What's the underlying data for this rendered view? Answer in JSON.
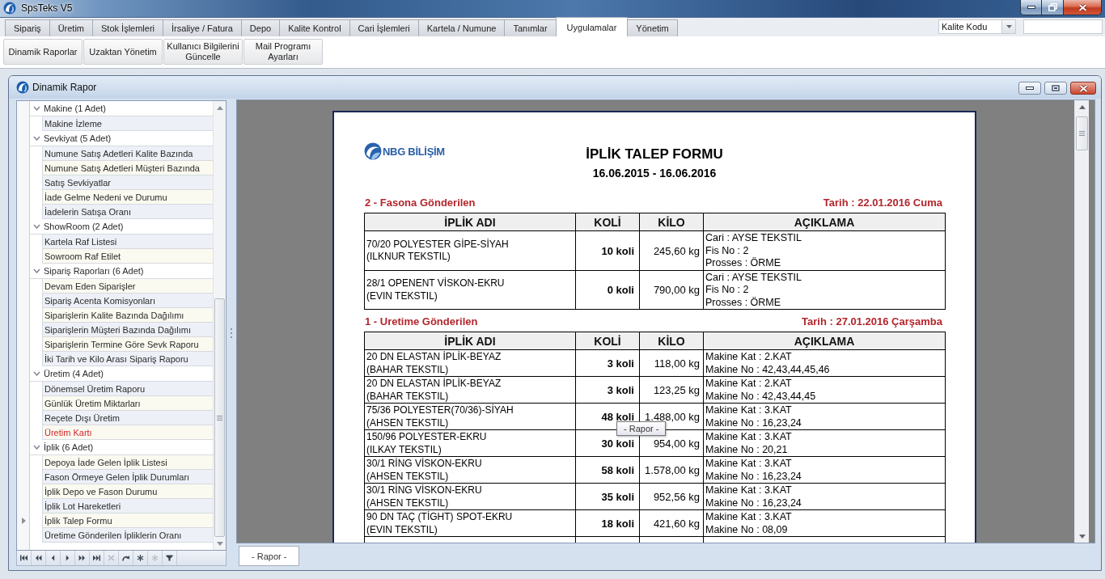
{
  "window": {
    "title": "SpsTeks V5"
  },
  "menu_tabs": [
    {
      "label": "Sipariş",
      "selected": false
    },
    {
      "label": "Üretim",
      "selected": false
    },
    {
      "label": "Stok İşlemleri",
      "selected": false
    },
    {
      "label": "İrsaliye / Fatura",
      "selected": false
    },
    {
      "label": "Depo",
      "selected": false
    },
    {
      "label": "Kalite Kontrol",
      "selected": false
    },
    {
      "label": "Cari İşlemleri",
      "selected": false
    },
    {
      "label": "Kartela / Numune",
      "selected": false
    },
    {
      "label": "Tanımlar",
      "selected": false
    },
    {
      "label": "Uygulamalar",
      "selected": true
    },
    {
      "label": "Yönetim",
      "selected": false
    }
  ],
  "quick_search": {
    "field": "Kalite Kodu"
  },
  "ribbon": {
    "buttons": [
      "Dinamik Raporlar",
      "Uzaktan Yönetim",
      "Kullanıcı Bilgilerini\nGüncelle",
      "Mail Programı\nAyarları"
    ]
  },
  "child_window": {
    "title": "Dinamik Rapor"
  },
  "report_tree": {
    "groups": [
      {
        "label": "Makine (1 Adet)",
        "expanded": true,
        "children": [
          {
            "label": "Makine İzleme",
            "selected": false,
            "highlighted": false
          }
        ]
      },
      {
        "label": "Sevkiyat (5 Adet)",
        "expanded": true,
        "children": [
          {
            "label": "Numune Satış Adetleri Kalite Bazında",
            "selected": false,
            "highlighted": false
          },
          {
            "label": "Numune Satış Adetleri Müşteri Bazında",
            "selected": false,
            "highlighted": false
          },
          {
            "label": "Satış Sevkiyatlar",
            "selected": false,
            "highlighted": false
          },
          {
            "label": "İade Gelme Nedeni ve Durumu",
            "selected": false,
            "highlighted": false
          },
          {
            "label": "İadelerin Satışa Oranı",
            "selected": false,
            "highlighted": false
          }
        ]
      },
      {
        "label": "ShowRoom (2 Adet)",
        "expanded": true,
        "children": [
          {
            "label": "Kartela Raf Listesi",
            "selected": false,
            "highlighted": false
          },
          {
            "label": "Sowroom Raf Etilet",
            "selected": false,
            "highlighted": false
          }
        ]
      },
      {
        "label": "Sipariş Raporları (6 Adet)",
        "expanded": true,
        "children": [
          {
            "label": "Devam Eden Siparişler",
            "selected": false,
            "highlighted": false
          },
          {
            "label": "Sipariş Acenta Komisyonları",
            "selected": false,
            "highlighted": false
          },
          {
            "label": "Siparişlerin Kalite Bazında Dağılımı",
            "selected": false,
            "highlighted": false
          },
          {
            "label": "Siparişlerin Müşteri Bazında Dağılımı",
            "selected": false,
            "highlighted": false
          },
          {
            "label": "Siparişlerin Termine Göre Sevk Raporu",
            "selected": false,
            "highlighted": false
          },
          {
            "label": "İki Tarih ve Kilo Arası Sipariş Raporu",
            "selected": false,
            "highlighted": false
          }
        ]
      },
      {
        "label": "Üretim (4 Adet)",
        "expanded": true,
        "children": [
          {
            "label": "Dönemsel Üretim Raporu",
            "selected": false,
            "highlighted": false
          },
          {
            "label": "Günlük Üretim Miktarları",
            "selected": false,
            "highlighted": false
          },
          {
            "label": "Reçete Dışı Üretim",
            "selected": false,
            "highlighted": false
          },
          {
            "label": "Üretim Kartı",
            "selected": false,
            "highlighted": true
          }
        ]
      },
      {
        "label": "İplik (6 Adet)",
        "expanded": true,
        "children": [
          {
            "label": "Depoya İade Gelen İplik Listesi",
            "selected": false,
            "highlighted": false
          },
          {
            "label": "Fason Örmeye Gelen İplik Durumları",
            "selected": false,
            "highlighted": false
          },
          {
            "label": "İplik Depo ve Fason Durumu",
            "selected": false,
            "highlighted": false
          },
          {
            "label": "İplik Lot Hareketleri",
            "selected": false,
            "highlighted": false
          },
          {
            "label": "İplik Talep Formu",
            "selected": true,
            "highlighted": false
          },
          {
            "label": "Üretime Gönderilen İpliklerin Oranı",
            "selected": false,
            "highlighted": false
          }
        ]
      }
    ],
    "navigator": [
      {
        "kind": "first",
        "disabled": false
      },
      {
        "kind": "prev_page",
        "disabled": false
      },
      {
        "kind": "prev",
        "disabled": false
      },
      {
        "kind": "next",
        "disabled": false
      },
      {
        "kind": "next_page",
        "disabled": false
      },
      {
        "kind": "last",
        "disabled": false
      },
      {
        "kind": "remove",
        "disabled": true
      },
      {
        "kind": "edit",
        "disabled": false
      },
      {
        "kind": "append",
        "disabled": false
      },
      {
        "kind": "cancel",
        "disabled": true
      },
      {
        "kind": "filter",
        "disabled": false
      }
    ]
  },
  "report_viewer": {
    "page": {
      "logo": "NBG BİLİŞİM",
      "title": "İPLİK TALEP FORMU",
      "period": "16.06.2015 - 16.06.2016",
      "sections": [
        {
          "heading": "2 - Fasona Gönderilen",
          "date": "Tarih : 22.01.2016 Cuma",
          "columns": [
            "İPLİK ADI",
            "KOLİ",
            "KİLO",
            "AÇIKLAMA"
          ],
          "rows": [
            {
              "yarn": "70/20 POLYESTER GİPE-SİYAH\n(ILKNUR TEKSTIL)",
              "koli": "10 koli",
              "kilo": "245,60 kg",
              "note": "Cari : AYSE TEKSTIL\nFis No : 2\nProsses : ÖRME"
            },
            {
              "yarn": "28/1 OPENENT VİSKON-EKRU\n(EVIN TEKSTIL)",
              "koli": "0 koli",
              "kilo": "790,00 kg",
              "note": "Cari : AYSE TEKSTIL\nFis No : 2\nProsses : ÖRME"
            }
          ]
        },
        {
          "heading": "1 - Uretime Gönderilen",
          "date": "Tarih : 27.01.2016 Çarşamba",
          "columns": [
            "İPLİK ADI",
            "KOLİ",
            "KİLO",
            "AÇIKLAMA"
          ],
          "rows": [
            {
              "yarn": "20 DN ELASTAN İPLİK-BEYAZ\n(BAHAR TEKSTIL)",
              "koli": "3 koli",
              "kilo": "118,00 kg",
              "note": "Makine Kat : 2.KAT\nMakine No : 42,43,44,45,46"
            },
            {
              "yarn": "20 DN ELASTAN İPLİK-BEYAZ\n(BAHAR TEKSTIL)",
              "koli": "3 koli",
              "kilo": "123,25 kg",
              "note": "Makine Kat : 2.KAT\nMakine No : 42,43,44,45"
            },
            {
              "yarn": "75/36 POLYESTER(70/36)-SİYAH\n(AHSEN TEKSTIL)",
              "koli": "48 koli",
              "kilo": "1.488,00 kg",
              "note": "Makine Kat : 3.KAT\nMakine No : 16,23,24"
            },
            {
              "yarn": "150/96 POLYESTER-EKRU\n(ILKAY TEKSTIL)",
              "koli": "30 koli",
              "kilo": "954,00 kg",
              "note": "Makine Kat : 3.KAT\nMakine No : 20,21"
            },
            {
              "yarn": "30/1 RİNG VİSKON-EKRU\n(AHSEN TEKSTIL)",
              "koli": "58 koli",
              "kilo": "1.578,00 kg",
              "note": "Makine Kat : 3.KAT\nMakine No : 16,23,24"
            },
            {
              "yarn": "30/1 RİNG VİSKON-EKRU\n(AHSEN TEKSTIL)",
              "koli": "35 koli",
              "kilo": "952,56 kg",
              "note": "Makine Kat : 3.KAT\nMakine No : 16,23,24"
            },
            {
              "yarn": "90 DN TAÇ (TİGHT) SPOT-EKRU\n(EVIN TEKSTIL)",
              "koli": "18 koli",
              "kilo": "421,60 kg",
              "note": "Makine Kat : 3.KAT\nMakine No : 08,09"
            }
          ]
        }
      ]
    },
    "tooltip": "- Rapor -",
    "tabs": [
      {
        "label": "- Rapor -",
        "selected": true
      }
    ]
  }
}
